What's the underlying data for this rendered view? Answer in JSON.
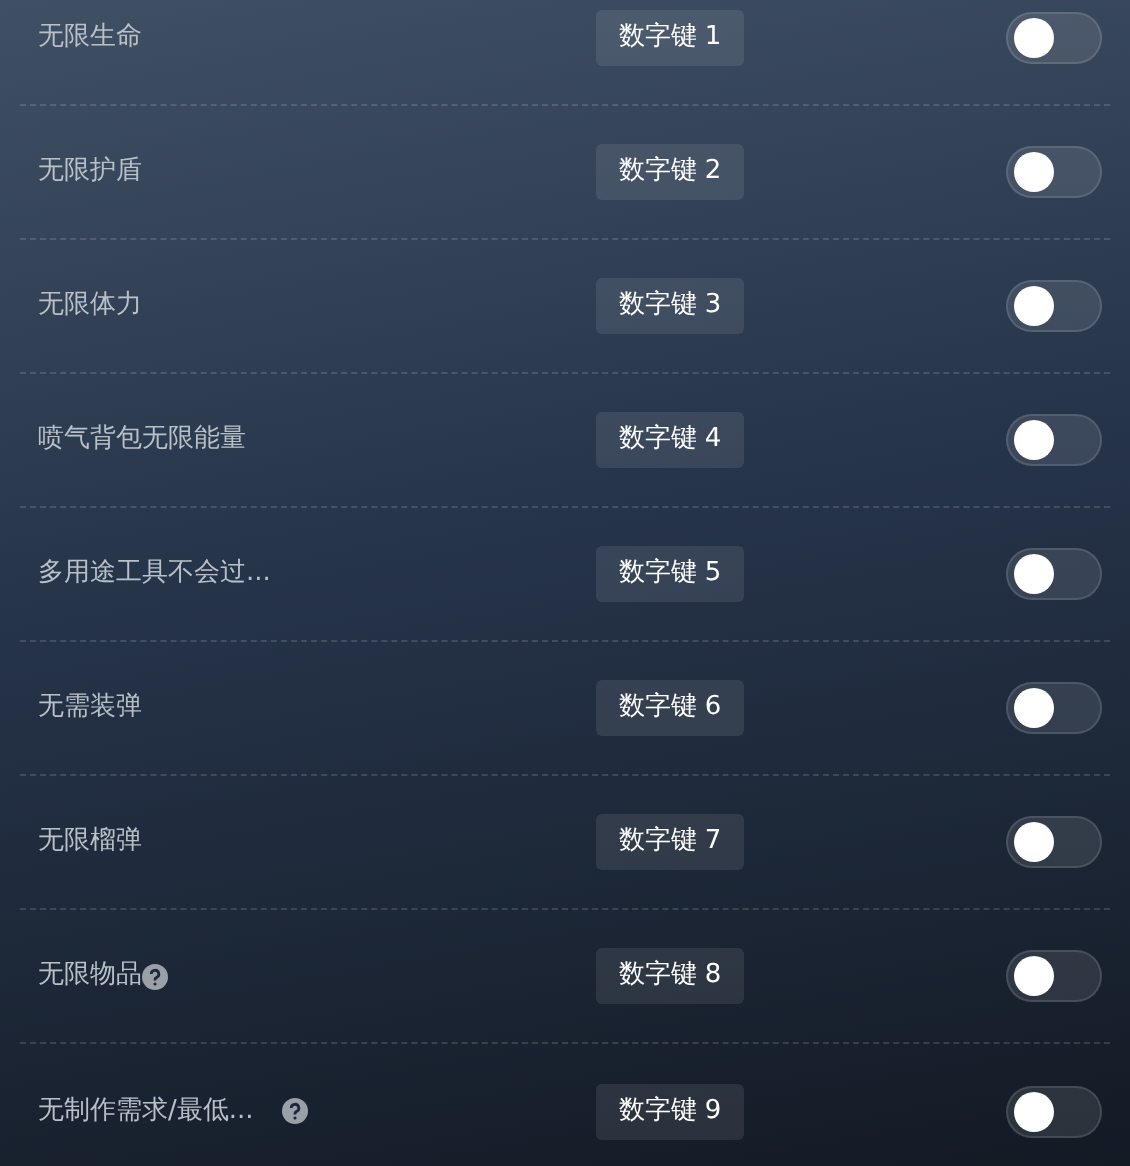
{
  "cheats": [
    {
      "label": "无限生命",
      "hotkey": "数字键 1",
      "on": false,
      "help": false
    },
    {
      "label": "无限护盾",
      "hotkey": "数字键 2",
      "on": false,
      "help": false
    },
    {
      "label": "无限体力",
      "hotkey": "数字键 3",
      "on": false,
      "help": false
    },
    {
      "label": "喷气背包无限能量",
      "hotkey": "数字键 4",
      "on": false,
      "help": false
    },
    {
      "label": "多用途工具不会过...",
      "hotkey": "数字键 5",
      "on": false,
      "help": false
    },
    {
      "label": "无需装弹",
      "hotkey": "数字键 6",
      "on": false,
      "help": false
    },
    {
      "label": "无限榴弹",
      "hotkey": "数字键 7",
      "on": false,
      "help": false
    },
    {
      "label": "无限物品",
      "hotkey": "数字键 8",
      "on": false,
      "help": true
    },
    {
      "label": "无制作需求/最低...",
      "hotkey": "数字键 9",
      "on": false,
      "help": true
    }
  ]
}
